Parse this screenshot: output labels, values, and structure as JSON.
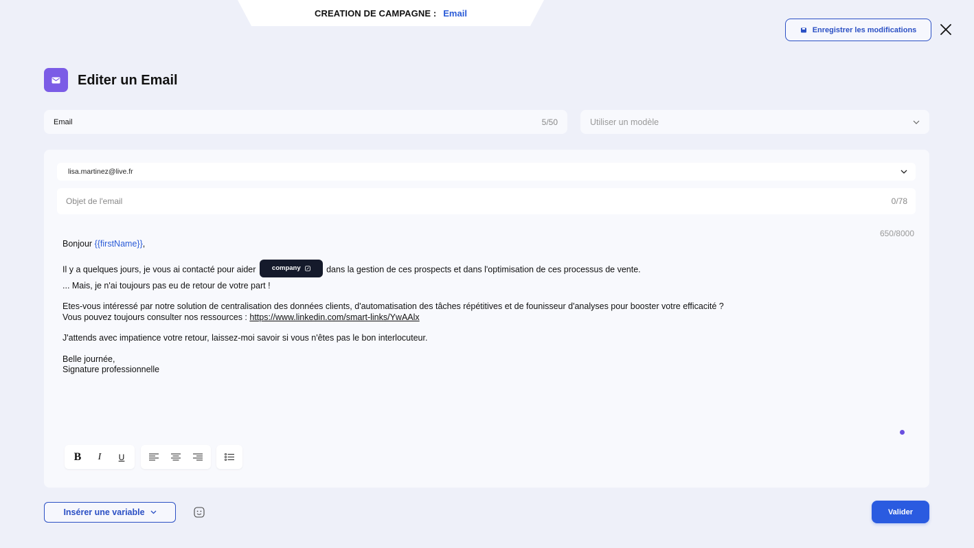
{
  "header": {
    "campaign_label": "CREATION DE CAMPAGNE :",
    "campaign_type": "Email",
    "save_label": "Enregistrer les modifications"
  },
  "page": {
    "title": "Editer un Email"
  },
  "name_field": {
    "value": "Email",
    "counter": "5/50"
  },
  "template_select": {
    "placeholder": "Utiliser un modèle"
  },
  "editor": {
    "sender": "lisa.martinez@live.fr",
    "subject_placeholder": "Objet de l'email",
    "subject_counter": "0/78",
    "body_counter": "650/8000",
    "body": {
      "greeting_prefix": "Bonjour ",
      "greeting_var": "{{firstName}}",
      "greeting_suffix": ",",
      "p1_before": "Il y a quelques jours, je vous ai contacté pour aider",
      "p1_chip": "company",
      "p1_after": "dans la gestion de ces prospects et dans l'optimisation de ces processus de vente.",
      "p1_line2": "... Mais, je n'ai toujours pas eu de retour de votre part !",
      "p2_line1": "Etes-vous intéressé par notre solution de centralisation des données clients, d'automatisation des tâches répétitives et de founisseur d'analyses pour booster votre efficacité ?",
      "p2_line2_prefix": "Vous pouvez toujours consulter nos ressources : ",
      "p2_link": "https://www.linkedin.com/smart-links/YwAAlx",
      "p3": "J'attends avec impatience votre retour, laissez-moi savoir si vous n'êtes pas le bon interlocuteur.",
      "p4_line1": "Belle journée,",
      "p4_line2": "Signature professionnelle"
    },
    "toolbar": {
      "bold": "B",
      "italic": "I",
      "underline": "U"
    }
  },
  "footer": {
    "insert_variable_label": "Insérer une variable",
    "validate_label": "Valider"
  },
  "colors": {
    "accent": "#2a5be0",
    "purple": "#7b5ce6",
    "background": "#eef0f9"
  }
}
